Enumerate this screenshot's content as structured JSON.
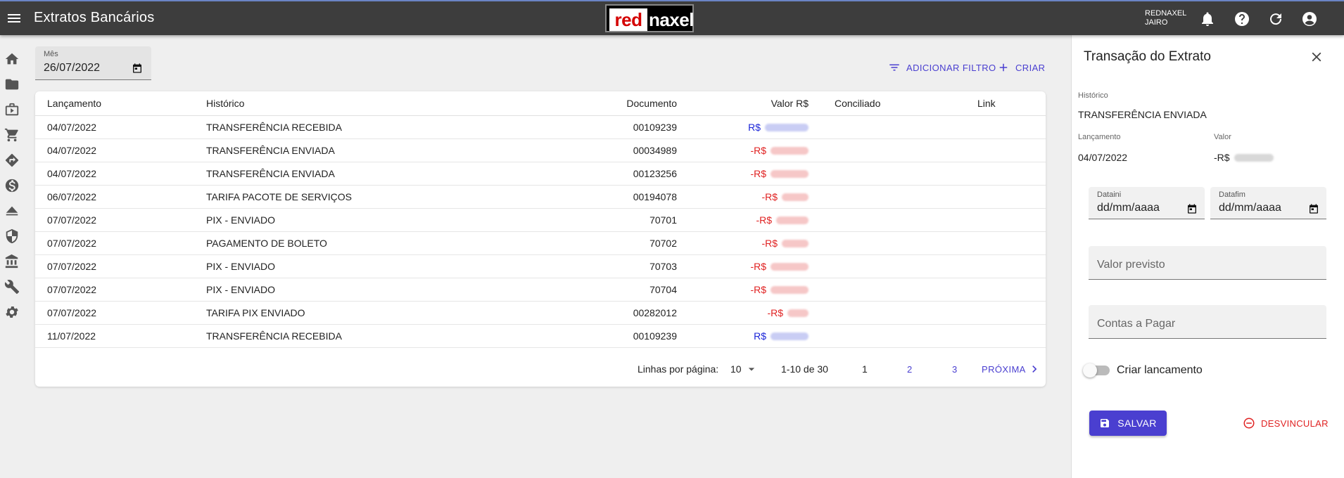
{
  "app": {
    "title": "Extratos Bancários"
  },
  "logo": {
    "part1": "red",
    "part2": "naxel"
  },
  "user": {
    "company": "REDNAXEL",
    "name": "JAIRO"
  },
  "filter": {
    "month_label": "Mês",
    "month_value": "26/07/2022"
  },
  "actions": {
    "add_filter": "ADICIONAR FILTRO",
    "create": "CRIAR"
  },
  "table": {
    "headers": [
      "Lançamento",
      "Histórico",
      "Documento",
      "Valor R$",
      "Conciliado",
      "Link"
    ],
    "rows": [
      {
        "date": "04/07/2022",
        "hist": "TRANSFERÊNCIA RECEBIDA",
        "doc": "00109239",
        "prefix": "R$",
        "sign": "pos"
      },
      {
        "date": "04/07/2022",
        "hist": "TRANSFERÊNCIA ENVIADA",
        "doc": "00034989",
        "prefix": "-R$",
        "sign": "neg"
      },
      {
        "date": "04/07/2022",
        "hist": "TRANSFERÊNCIA ENVIADA",
        "doc": "00123256",
        "prefix": "-R$",
        "sign": "neg"
      },
      {
        "date": "06/07/2022",
        "hist": "TARIFA PACOTE DE SERVIÇOS",
        "doc": "00194078",
        "prefix": "-R$",
        "sign": "neg"
      },
      {
        "date": "07/07/2022",
        "hist": "PIX - ENVIADO",
        "doc": "70701",
        "prefix": "-R$",
        "sign": "neg"
      },
      {
        "date": "07/07/2022",
        "hist": "PAGAMENTO DE BOLETO",
        "doc": "70702",
        "prefix": "-R$",
        "sign": "neg"
      },
      {
        "date": "07/07/2022",
        "hist": "PIX - ENVIADO",
        "doc": "70703",
        "prefix": "-R$",
        "sign": "neg"
      },
      {
        "date": "07/07/2022",
        "hist": "PIX - ENVIADO",
        "doc": "70704",
        "prefix": "-R$",
        "sign": "neg"
      },
      {
        "date": "07/07/2022",
        "hist": "TARIFA PIX ENVIADO",
        "doc": "00282012",
        "prefix": "-R$",
        "sign": "neg"
      },
      {
        "date": "11/07/2022",
        "hist": "TRANSFERÊNCIA RECEBIDA",
        "doc": "00109239",
        "prefix": "R$",
        "sign": "pos"
      }
    ]
  },
  "pagination": {
    "rows_label": "Linhas por página:",
    "rows_value": "10",
    "range": "1-10 de 30",
    "pages": [
      "1",
      "2",
      "3"
    ],
    "next": "PRÓXIMA"
  },
  "panel": {
    "title": "Transação do Extrato",
    "historico_label": "Histórico",
    "historico_value": "TRANSFERÊNCIA ENVIADA",
    "lancamento_label": "Lançamento",
    "lancamento_value": "04/07/2022",
    "valor_label": "Valor",
    "valor_prefix": "-R$",
    "datainI_label": "Dataini",
    "dataini_value": "dd/mm/aaaa",
    "datafim_label": "Datafim",
    "datafim_value": "dd/mm/aaaa",
    "valor_previsto_placeholder": "Valor previsto",
    "contas_placeholder": "Contas a Pagar",
    "toggle_label": "Criar lancamento",
    "save": "SALVAR",
    "unlink": "DESVINCULAR"
  },
  "colors": {
    "accent": "#4a3fd0",
    "positive": "#1b25d8",
    "negative": "#e02222",
    "topbar": "#3d3d3d"
  }
}
